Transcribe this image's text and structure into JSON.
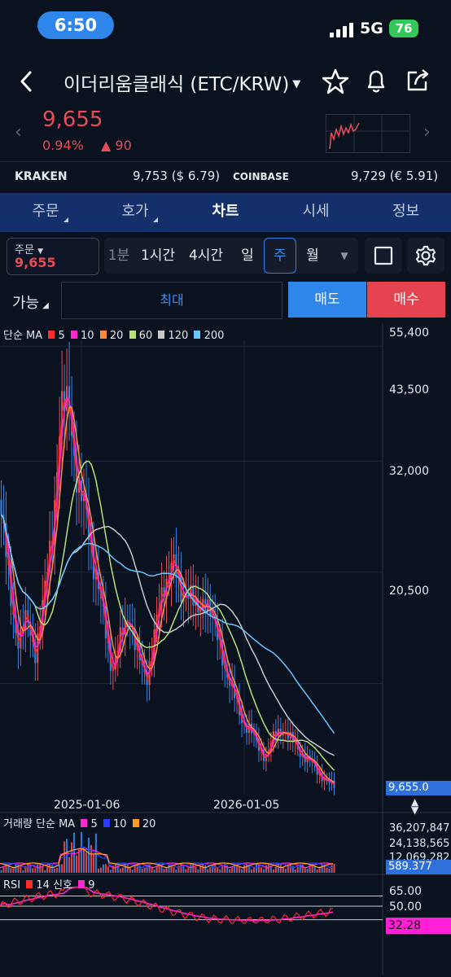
{
  "status": {
    "time": "6:50",
    "network": "5G",
    "battery": "76"
  },
  "header": {
    "title": "이더리움클래식 (ETC/KRW)"
  },
  "price": {
    "last": "9,655",
    "change_pct": "0.94%",
    "change_abs": "90",
    "direction": "up"
  },
  "exchanges": [
    {
      "name": "KRAKEN",
      "value": "9,753 ($ 6.79)"
    },
    {
      "name": "COINBASE",
      "value": "9,729 (€ 5.91)"
    }
  ],
  "tabs": [
    {
      "label": "주문",
      "active": false
    },
    {
      "label": "호가",
      "active": false
    },
    {
      "label": "차트",
      "active": true
    },
    {
      "label": "시세",
      "active": false
    },
    {
      "label": "정보",
      "active": false
    }
  ],
  "order": {
    "label": "주문",
    "price": "9,655"
  },
  "timeframes": [
    {
      "label": "1분",
      "state": "dim"
    },
    {
      "label": "1시간",
      "state": "normal"
    },
    {
      "label": "4시간",
      "state": "normal"
    },
    {
      "label": "일",
      "state": "normal"
    },
    {
      "label": "주",
      "state": "selected"
    },
    {
      "label": "월",
      "state": "normal"
    }
  ],
  "trade": {
    "avail_label": "가능",
    "max_label": "최대",
    "sell_label": "매도",
    "buy_label": "매수"
  },
  "colors": {
    "up": "#e84c57",
    "down": "#2f86ea",
    "accent": "#2f86ea",
    "tab_bg": "#14306b"
  },
  "chart_data": {
    "type": "candlestick",
    "legend": {
      "label": "단순 MA",
      "items": [
        {
          "name": "5",
          "color": "#ff2a2a"
        },
        {
          "name": "10",
          "color": "#ff28d0"
        },
        {
          "name": "20",
          "color": "#ff8a3d"
        },
        {
          "name": "60",
          "color": "#b8e07a"
        },
        {
          "name": "120",
          "color": "#c8c8c8"
        },
        {
          "name": "200",
          "color": "#69c3ff"
        }
      ]
    },
    "y_ticks": [
      "55,400",
      "43,500",
      "32,000",
      "20,500"
    ],
    "x_ticks": [
      "2025-01-06",
      "2026-01-05"
    ],
    "last_price_label": "9,655.0",
    "ylim": [
      9000,
      56000
    ],
    "close_series": [
      38000,
      30000,
      25000,
      27000,
      24000,
      29000,
      37000,
      48000,
      50000,
      40000,
      38000,
      32000,
      27000,
      22000,
      25000,
      28000,
      23000,
      21000,
      26000,
      30000,
      34000,
      29000,
      31000,
      27000,
      30000,
      26000,
      23000,
      20000,
      17000,
      16000,
      14000,
      13000,
      15000,
      16000,
      14500,
      13500,
      12500,
      11500,
      10500,
      9655
    ],
    "volume": {
      "label": "거래량 단순 MA",
      "items": [
        {
          "name": "5",
          "color": "#ff28d0"
        },
        {
          "name": "10",
          "color": "#2a3cff"
        },
        {
          "name": "20",
          "color": "#ff9a1f"
        }
      ],
      "ticks": [
        "36,207,847",
        "24,138,565",
        "12,069,282"
      ],
      "last_label": "589.377"
    },
    "rsi": {
      "label": "RSI",
      "period": "14",
      "signal_label": "신호",
      "signal_period": "9",
      "ticks": [
        "65.00",
        "50.00"
      ],
      "last_label": "32.28"
    }
  }
}
